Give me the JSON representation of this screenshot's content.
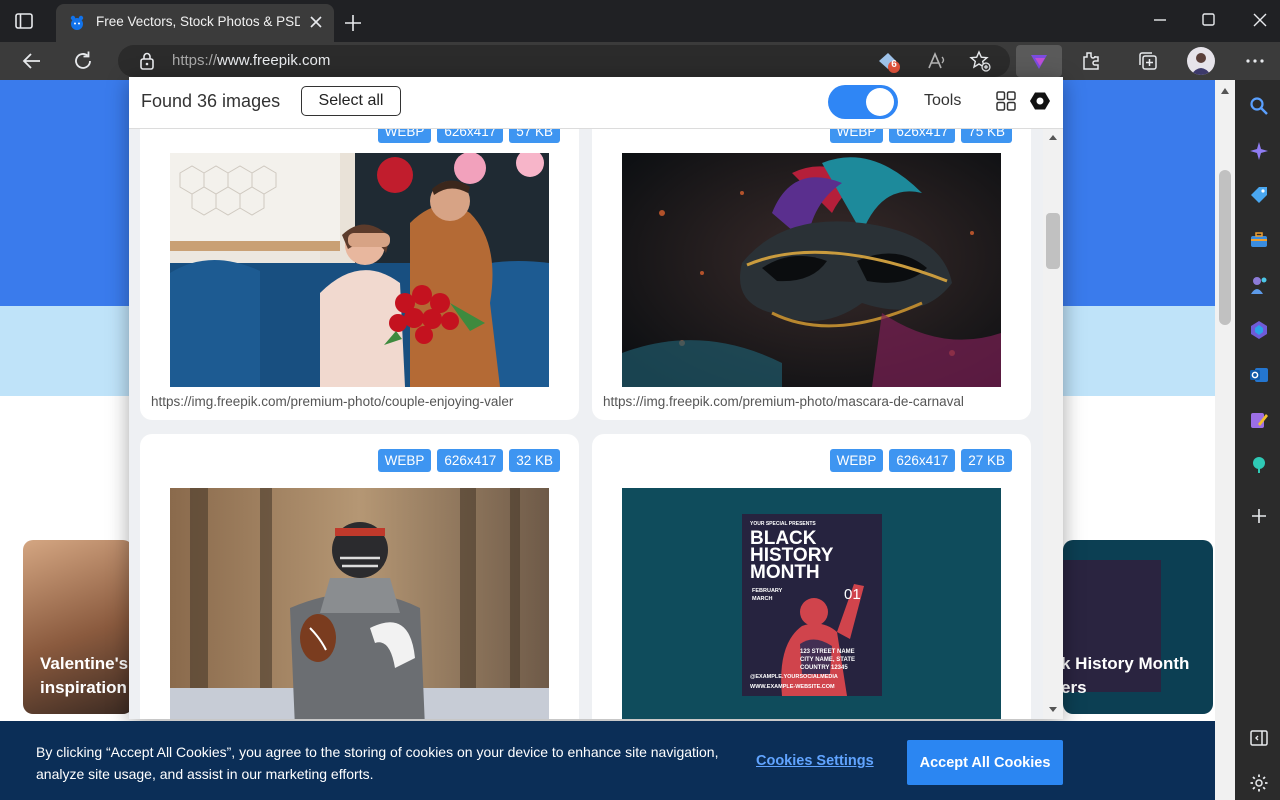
{
  "browser": {
    "tab_title": "Free Vectors, Stock Photos & PSD",
    "url_protocol": "https://",
    "url_host": "www.freepik.com",
    "extension_badge": "6"
  },
  "popup": {
    "found_label": "Found 36 images",
    "select_all_label": "Select all",
    "tools_label": "Tools",
    "toggle_on": true,
    "cards": [
      {
        "badges": [
          "WEBP",
          "626x417",
          "57 KB"
        ],
        "url": "https://img.freepik.com/premium-photo/couple-enjoying-valer"
      },
      {
        "badges": [
          "WEBP",
          "626x417",
          "75 KB"
        ],
        "url": "https://img.freepik.com/premium-photo/mascara-de-carnaval"
      },
      {
        "badges": [
          "WEBP",
          "626x417",
          "32 KB"
        ],
        "url": ""
      },
      {
        "badges": [
          "WEBP",
          "626x417",
          "27 KB"
        ],
        "url": ""
      }
    ],
    "poster": {
      "kicker": "YOUR SPECIAL PRESENTS",
      "title_line1": "BLACK",
      "title_line2": "HISTORY",
      "title_line3": "MONTH",
      "date_month": "FEBRUARY",
      "date_next": "MARCH",
      "date_day": "01",
      "address1": "123 STREET NAME",
      "address2": "CITY NAME, STATE",
      "address3": "COUNTRY 12345",
      "social": "@EXAMPLE.YOURSOCIALMEDIA",
      "website": "WWW.EXAMPLE-WEBSITE.COM"
    }
  },
  "page": {
    "card_left_line1": "Valentine's",
    "card_left_line2": "inspiration",
    "card_right_line1": "k History Month",
    "card_right_line2": "ers"
  },
  "cookie": {
    "text": "By clicking “Accept All Cookies”, you agree to the storing of cookies on your device to enhance site navigation, analyze site usage, and assist in our marketing efforts.",
    "settings_label": "Cookies Settings",
    "accept_label": "Accept All Cookies"
  },
  "colors": {
    "accent": "#2f86f5",
    "badge": "#3e95f1",
    "cookie_bg": "#0b2e57",
    "hero": "#3a7bec"
  }
}
